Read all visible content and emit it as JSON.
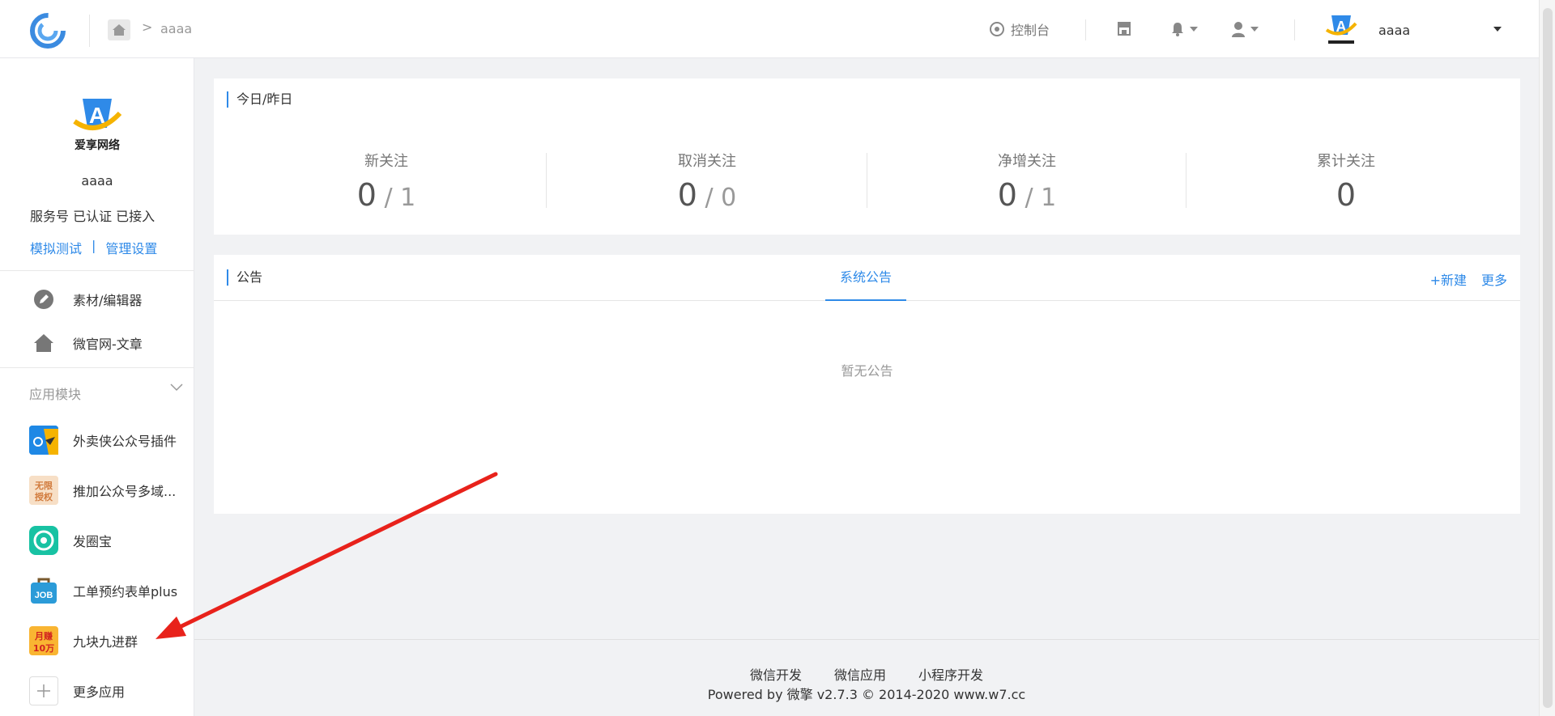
{
  "header": {
    "breadcrumb_sep": ">",
    "breadcrumb_current": "aaaa",
    "console_label": "控制台",
    "account_name": "aaaa"
  },
  "sidebar": {
    "account": {
      "brand_text": "爱享网络",
      "name": "aaaa",
      "status": "服务号 已认证 已接入",
      "link_test": "模拟测试",
      "link_sep": "|",
      "link_settings": "管理设置"
    },
    "nav": [
      {
        "label": "素材/编辑器",
        "icon": "edit-icon"
      },
      {
        "label": "微官网-文章",
        "icon": "home-icon"
      }
    ],
    "section_title": "应用模块",
    "modules": [
      {
        "label": "外卖侠公众号插件",
        "icon": "waimaixia-icon"
      },
      {
        "label": "推加公众号多域...",
        "icon": "unlimited-auth-icon",
        "icon_text": "无限授权"
      },
      {
        "label": "发圈宝",
        "icon": "faquanbao-icon"
      },
      {
        "label": "工单预约表单plus",
        "icon": "job-icon",
        "icon_text": "JOB"
      },
      {
        "label": "九块九进群",
        "icon": "monthly-earn-icon",
        "icon_text": "月赚10万"
      },
      {
        "label": "更多应用",
        "icon": "plus-icon"
      }
    ]
  },
  "stats_card": {
    "title": "今日/昨日",
    "items": [
      {
        "label": "新关注",
        "today": "0",
        "sep": "/",
        "yesterday": "1"
      },
      {
        "label": "取消关注",
        "today": "0",
        "sep": "/",
        "yesterday": "0"
      },
      {
        "label": "净增关注",
        "today": "0",
        "sep": "/",
        "yesterday": "1"
      },
      {
        "label": "累计关注",
        "total": "0"
      }
    ]
  },
  "notice_card": {
    "title": "公告",
    "tab": "系统公告",
    "new_label": "+新建",
    "more_label": "更多",
    "empty_text": "暂无公告"
  },
  "footer": {
    "links": [
      "微信开发",
      "微信应用",
      "小程序开发"
    ],
    "copyright": "Powered by 微擎 v2.7.3 © 2014-2020 www.w7.cc"
  },
  "colors": {
    "accent": "#2f8ae8",
    "annotation_arrow": "#e8221b"
  }
}
